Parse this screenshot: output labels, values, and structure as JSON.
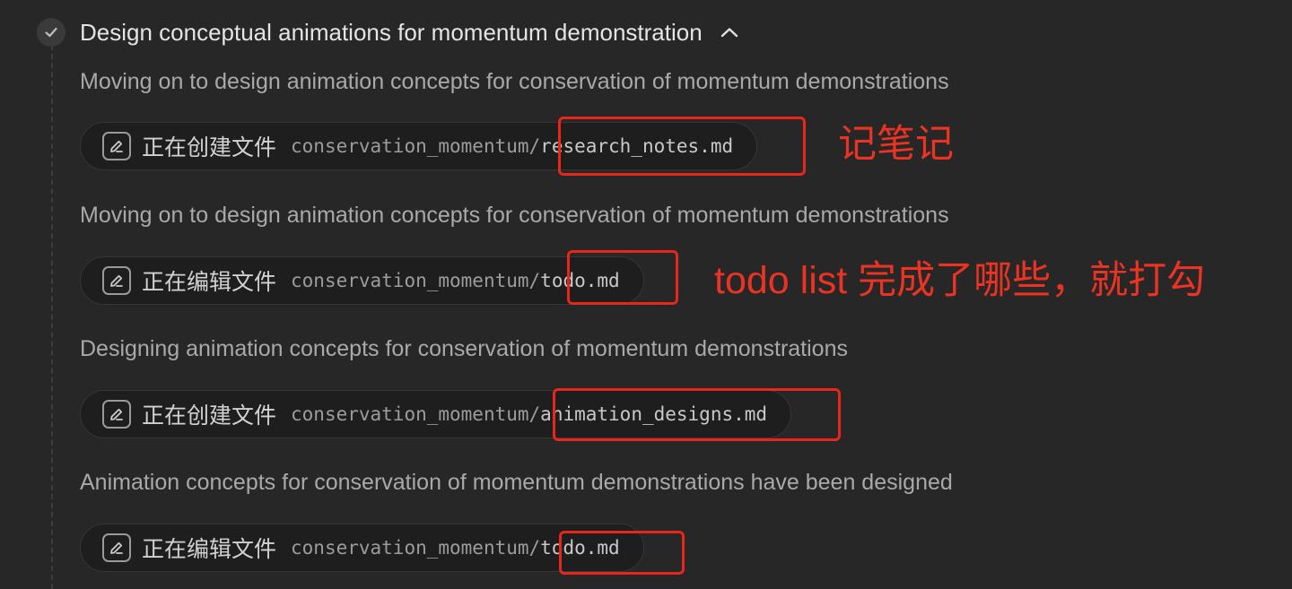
{
  "step": {
    "title": "Design conceptual animations for momentum demonstration"
  },
  "entries": [
    {
      "description": "Moving on to design animation concepts for conservation of momentum demonstrations",
      "action": "正在创建文件",
      "path_prefix": "conservation_momentum/",
      "file": "research_notes.md"
    },
    {
      "description": "Moving on to design animation concepts for conservation of momentum demonstrations",
      "action": "正在编辑文件",
      "path_prefix": "conservation_momentum/",
      "file": "todo.md"
    },
    {
      "description": "Designing animation concepts for conservation of momentum demonstrations",
      "action": "正在创建文件",
      "path_prefix": "conservation_momentum/",
      "file": "animation_designs.md"
    },
    {
      "description": "Animation concepts for conservation of momentum demonstrations have been designed",
      "action": "正在编辑文件",
      "path_prefix": "conservation_momentum/",
      "file": "todo.md"
    }
  ],
  "annotations": {
    "note_1": "记笔记",
    "note_2": "todo list 完成了哪些，就打勾"
  },
  "colors": {
    "background": "#272727",
    "annotation_red": "#e8261a",
    "chip_background": "#1e1e1e"
  },
  "icons": {
    "step_status": "check-icon",
    "collapse": "chevron-up-icon",
    "file_action": "edit-file-icon"
  }
}
